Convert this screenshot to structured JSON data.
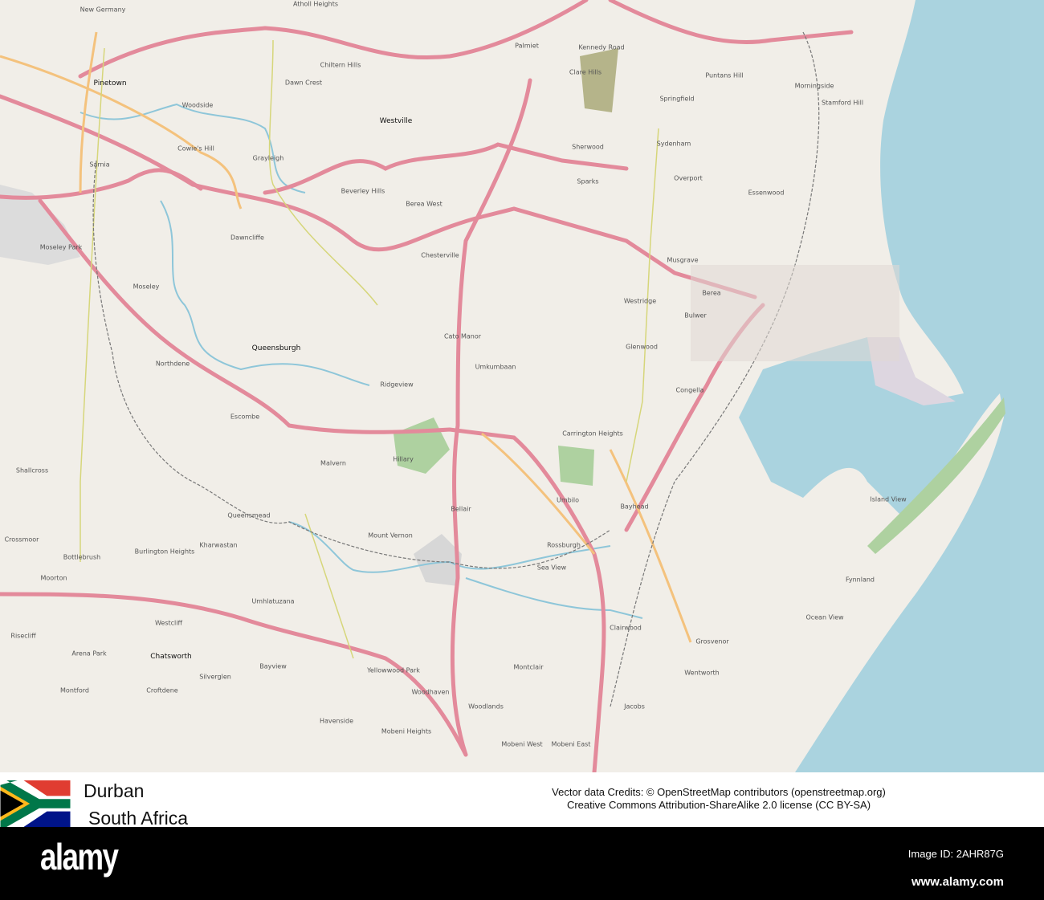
{
  "map": {
    "colors": {
      "land": "#f1eee8",
      "sea": "#aad3df",
      "motorway": "#e38a9b",
      "primary": "#f4c27d",
      "secondary": "#f7f7b0",
      "park": "#aed1a0",
      "river": "#8ec6d9",
      "industrial": "#ddd6e0"
    },
    "places": [
      "Pinetown",
      "Westville",
      "Woodside",
      "Cowie's Hill",
      "Dawn Crest",
      "Chiltern Hills",
      "Grayleigh",
      "Beverley Hills",
      "Berea West",
      "Chesterville",
      "Dawncliffe",
      "Moseley Park",
      "Moseley",
      "Queensburgh",
      "Northdene",
      "Cato Manor",
      "Umkumbaan",
      "Ridgeview",
      "Escombe",
      "Malvern",
      "Hillary",
      "Bellair",
      "Shallcross",
      "Queensmead",
      "Crossmoor",
      "Bottlebrush",
      "Burlington Heights",
      "Kharwastan",
      "Mount Vernon",
      "Moorton",
      "Umhlatuzana",
      "Westcliff",
      "Risecliff",
      "Arena Park",
      "Chatsworth",
      "Silverglen",
      "Bayview",
      "Montford",
      "Croftdene",
      "Havenside",
      "Mobeni Heights",
      "Yellowwood Park",
      "Woodhaven",
      "Montclair",
      "Woodlands",
      "Mobeni West",
      "Mobeni East",
      "Jacobs",
      "Clairwood",
      "Wentworth",
      "Grosvenor",
      "Ocean View",
      "Fynnland",
      "Island View",
      "Bayhead",
      "Umbilo",
      "Rossburgh",
      "Sea View",
      "Carrington Heights",
      "Congella",
      "Glenwood",
      "Bulwer",
      "Berea",
      "Musgrave",
      "Overport",
      "Essenwood",
      "Sydenham",
      "Springfield",
      "Sherwood",
      "Sparks",
      "Palmiet",
      "Kennedy Road",
      "Clare Hills",
      "Puntans Hill",
      "Morningside",
      "Stamford Hill",
      "Westridge",
      "Atholl Heights",
      "New Germany",
      "Sarnia"
    ]
  },
  "caption": {
    "city": "Durban",
    "country": "South Africa",
    "credit_line1": "Vector data Credits: © OpenStreetMap contributors (openstreetmap.org)",
    "credit_line2": "Creative Commons Attribution-ShareAlike 2.0 license (CC BY-SA)"
  },
  "footer": {
    "logo": "alamy",
    "image_id": "Image ID: 2AHR87G",
    "website": "www.alamy.com"
  }
}
